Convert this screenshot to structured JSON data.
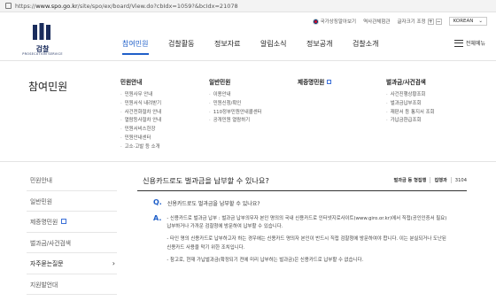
{
  "browser": {
    "url_scheme": "https://",
    "url_host": "www.spo.go.kr",
    "url_path": "/site/spo/ex/board/View.do?cbIdx=1059?&bcIdx=21078"
  },
  "utility": {
    "items": [
      "국가상징알아보기",
      "역사관체험관",
      "글자크기 조정"
    ],
    "zoom_plus": "+",
    "zoom_minus": "−",
    "language": "KOREAN",
    "language_arrow": "⌄"
  },
  "logo": {
    "name": "검찰",
    "subtitle": "PROSECUTION SERVICE"
  },
  "gnb": {
    "items": [
      "참여민원",
      "검찰활동",
      "정보자료",
      "알림소식",
      "정보공개",
      "검찰소개"
    ],
    "all_menu": "전체메뉴"
  },
  "mega": {
    "title": "참여민원",
    "columns": [
      {
        "head": "민원안내",
        "ext": false,
        "items": [
          "민원사무 안내",
          "민원서식 내려받기",
          "사건전화절차 안내",
          "열람등사절차 안내",
          "민원서비스헌장",
          "민원안내센터",
          "고소·고발 등 소개"
        ]
      },
      {
        "head": "일반민원",
        "ext": false,
        "items": [
          "이용안내",
          "민원신청/확인",
          "110정부민원안내콜센터",
          "공개민원 열람하기"
        ]
      },
      {
        "head": "제증명민원",
        "ext": true,
        "items": []
      },
      {
        "head": "벌과금/사건검색",
        "ext": false,
        "items": [
          "사건진행상황조회",
          "벌과금납부조회",
          "재판서 등 통지서 조회",
          "가납금환급조회"
        ]
      }
    ]
  },
  "sidebar": {
    "items": [
      {
        "label": "민원안내",
        "arrow": "",
        "ext": false
      },
      {
        "label": "일반민원",
        "arrow": "",
        "ext": false
      },
      {
        "label": "제증명민원",
        "arrow": "",
        "ext": true
      },
      {
        "label": "벌과금/사건검색",
        "arrow": "",
        "ext": false
      },
      {
        "label": "자주묻는질문",
        "arrow": "›",
        "ext": false
      },
      {
        "label": "지원발언대",
        "arrow": "",
        "ext": false
      }
    ]
  },
  "content": {
    "title": "신용카드로도 벌과금을 납부할 수 있나요?",
    "category": "벌과금 등 형집행",
    "dept_label": "집행과",
    "number": "3104",
    "q_mark": "Q.",
    "a_mark": "A.",
    "question": "신용카드로도 벌과금을 납부할 수 있나요?",
    "answer": [
      "- 신용카드로 벌과금 납부 : 벌과금 납부의무자 본인 명의의 국내 신용카드로 인터넷지로사이트(www.giro.or.kr)에서 직접(공인인증서 필요) 납부하거나 가까운 검찰청에 방문하여 납부할 수 있습니다.",
      "- 타인 명의 신용카드로 납부하고자 하는 경우에는 신용카드 명의자 본인이 반드시 직접 검찰청에 방문하여야 합니다. 이는 분실되거나 도난된 신용카드 사용을 막기 위한 조치입니다.",
      "- 참고로, 현재 가납벌과금(확정되기 전에 미리 납부하는 벌과금)은 신용카드로 납부할 수 없습니다."
    ]
  }
}
